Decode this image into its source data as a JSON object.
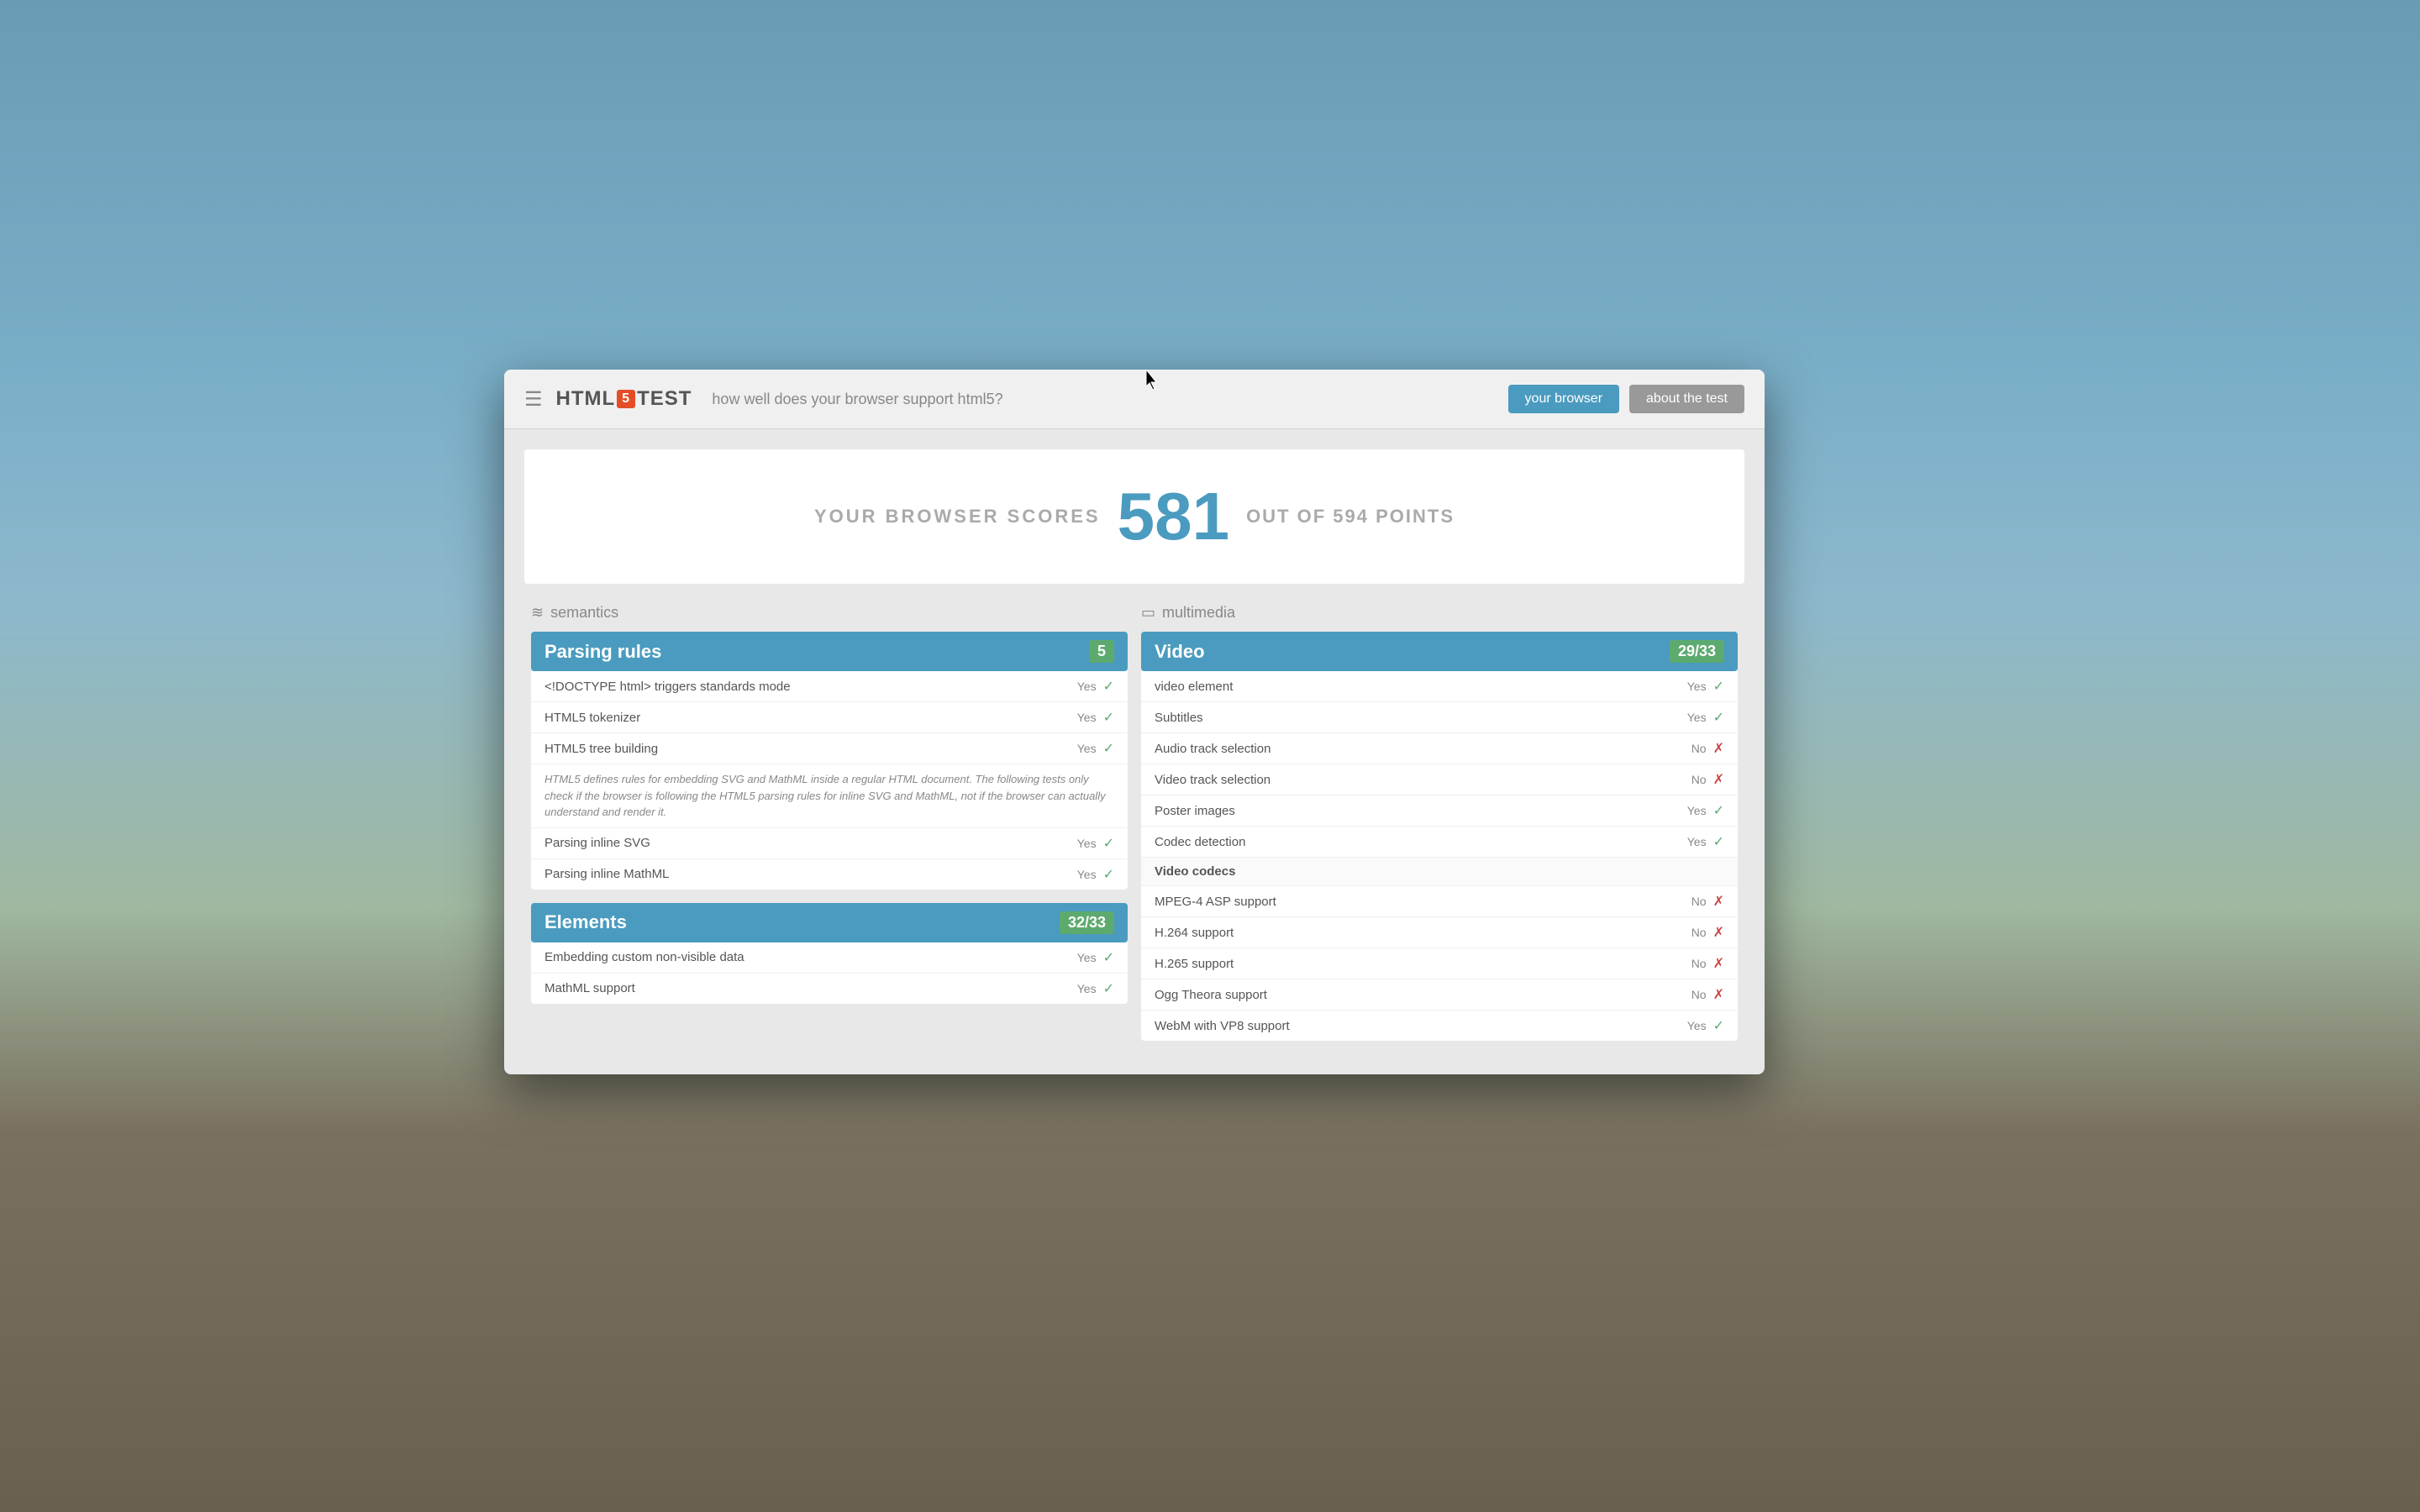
{
  "header": {
    "logo_html": "HTML",
    "logo_5": "5",
    "logo_test": "TEST",
    "tagline": "how well does your browser support html5?",
    "btn_your_browser": "your browser",
    "btn_about": "about the test"
  },
  "score": {
    "prefix": "YOUR BROWSER SCORES",
    "number": "581",
    "suffix": "OUT OF 594 POINTS"
  },
  "semantics": {
    "section_label": "semantics",
    "categories": [
      {
        "title": "Parsing rules",
        "score": "5",
        "features": [
          {
            "name": "<!DOCTYPE html> triggers standards mode",
            "value": "Yes",
            "status": "yes"
          },
          {
            "name": "HTML5 tokenizer",
            "value": "Yes",
            "status": "yes"
          },
          {
            "name": "HTML5 tree building",
            "value": "Yes",
            "status": "yes"
          }
        ],
        "description": "HTML5 defines rules for embedding SVG and MathML inside a regular HTML document. The following tests only check if the browser is following the HTML5 parsing rules for inline SVG and MathML, not if the browser can actually understand and render it.",
        "extra_features": [
          {
            "name": "Parsing inline SVG",
            "value": "Yes",
            "status": "yes"
          },
          {
            "name": "Parsing inline MathML",
            "value": "Yes",
            "status": "yes"
          }
        ]
      },
      {
        "title": "Elements",
        "score": "32/33",
        "features": [
          {
            "name": "Embedding custom non-visible data",
            "value": "Yes",
            "status": "yes"
          },
          {
            "name": "MathML support",
            "value": "Yes",
            "status": "yes"
          }
        ]
      }
    ]
  },
  "multimedia": {
    "section_label": "multimedia",
    "categories": [
      {
        "title": "Video",
        "score": "29/33",
        "features": [
          {
            "name": "video element",
            "value": "Yes",
            "status": "yes"
          },
          {
            "name": "Subtitles",
            "value": "Yes",
            "status": "yes"
          },
          {
            "name": "Audio track selection",
            "value": "No",
            "status": "no"
          },
          {
            "name": "Video track selection",
            "value": "No",
            "status": "no"
          },
          {
            "name": "Poster images",
            "value": "Yes",
            "status": "yes"
          },
          {
            "name": "Codec detection",
            "value": "Yes",
            "status": "yes"
          }
        ],
        "sub_sections": [
          {
            "title": "Video codecs",
            "features": [
              {
                "name": "MPEG-4 ASP support",
                "value": "No",
                "status": "no"
              },
              {
                "name": "H.264 support",
                "value": "No",
                "status": "no"
              },
              {
                "name": "H.265 support",
                "value": "No",
                "status": "no"
              },
              {
                "name": "Ogg Theora support",
                "value": "No",
                "status": "no"
              },
              {
                "name": "WebM with VP8 support",
                "value": "Yes",
                "status": "yes"
              }
            ]
          }
        ]
      }
    ]
  }
}
